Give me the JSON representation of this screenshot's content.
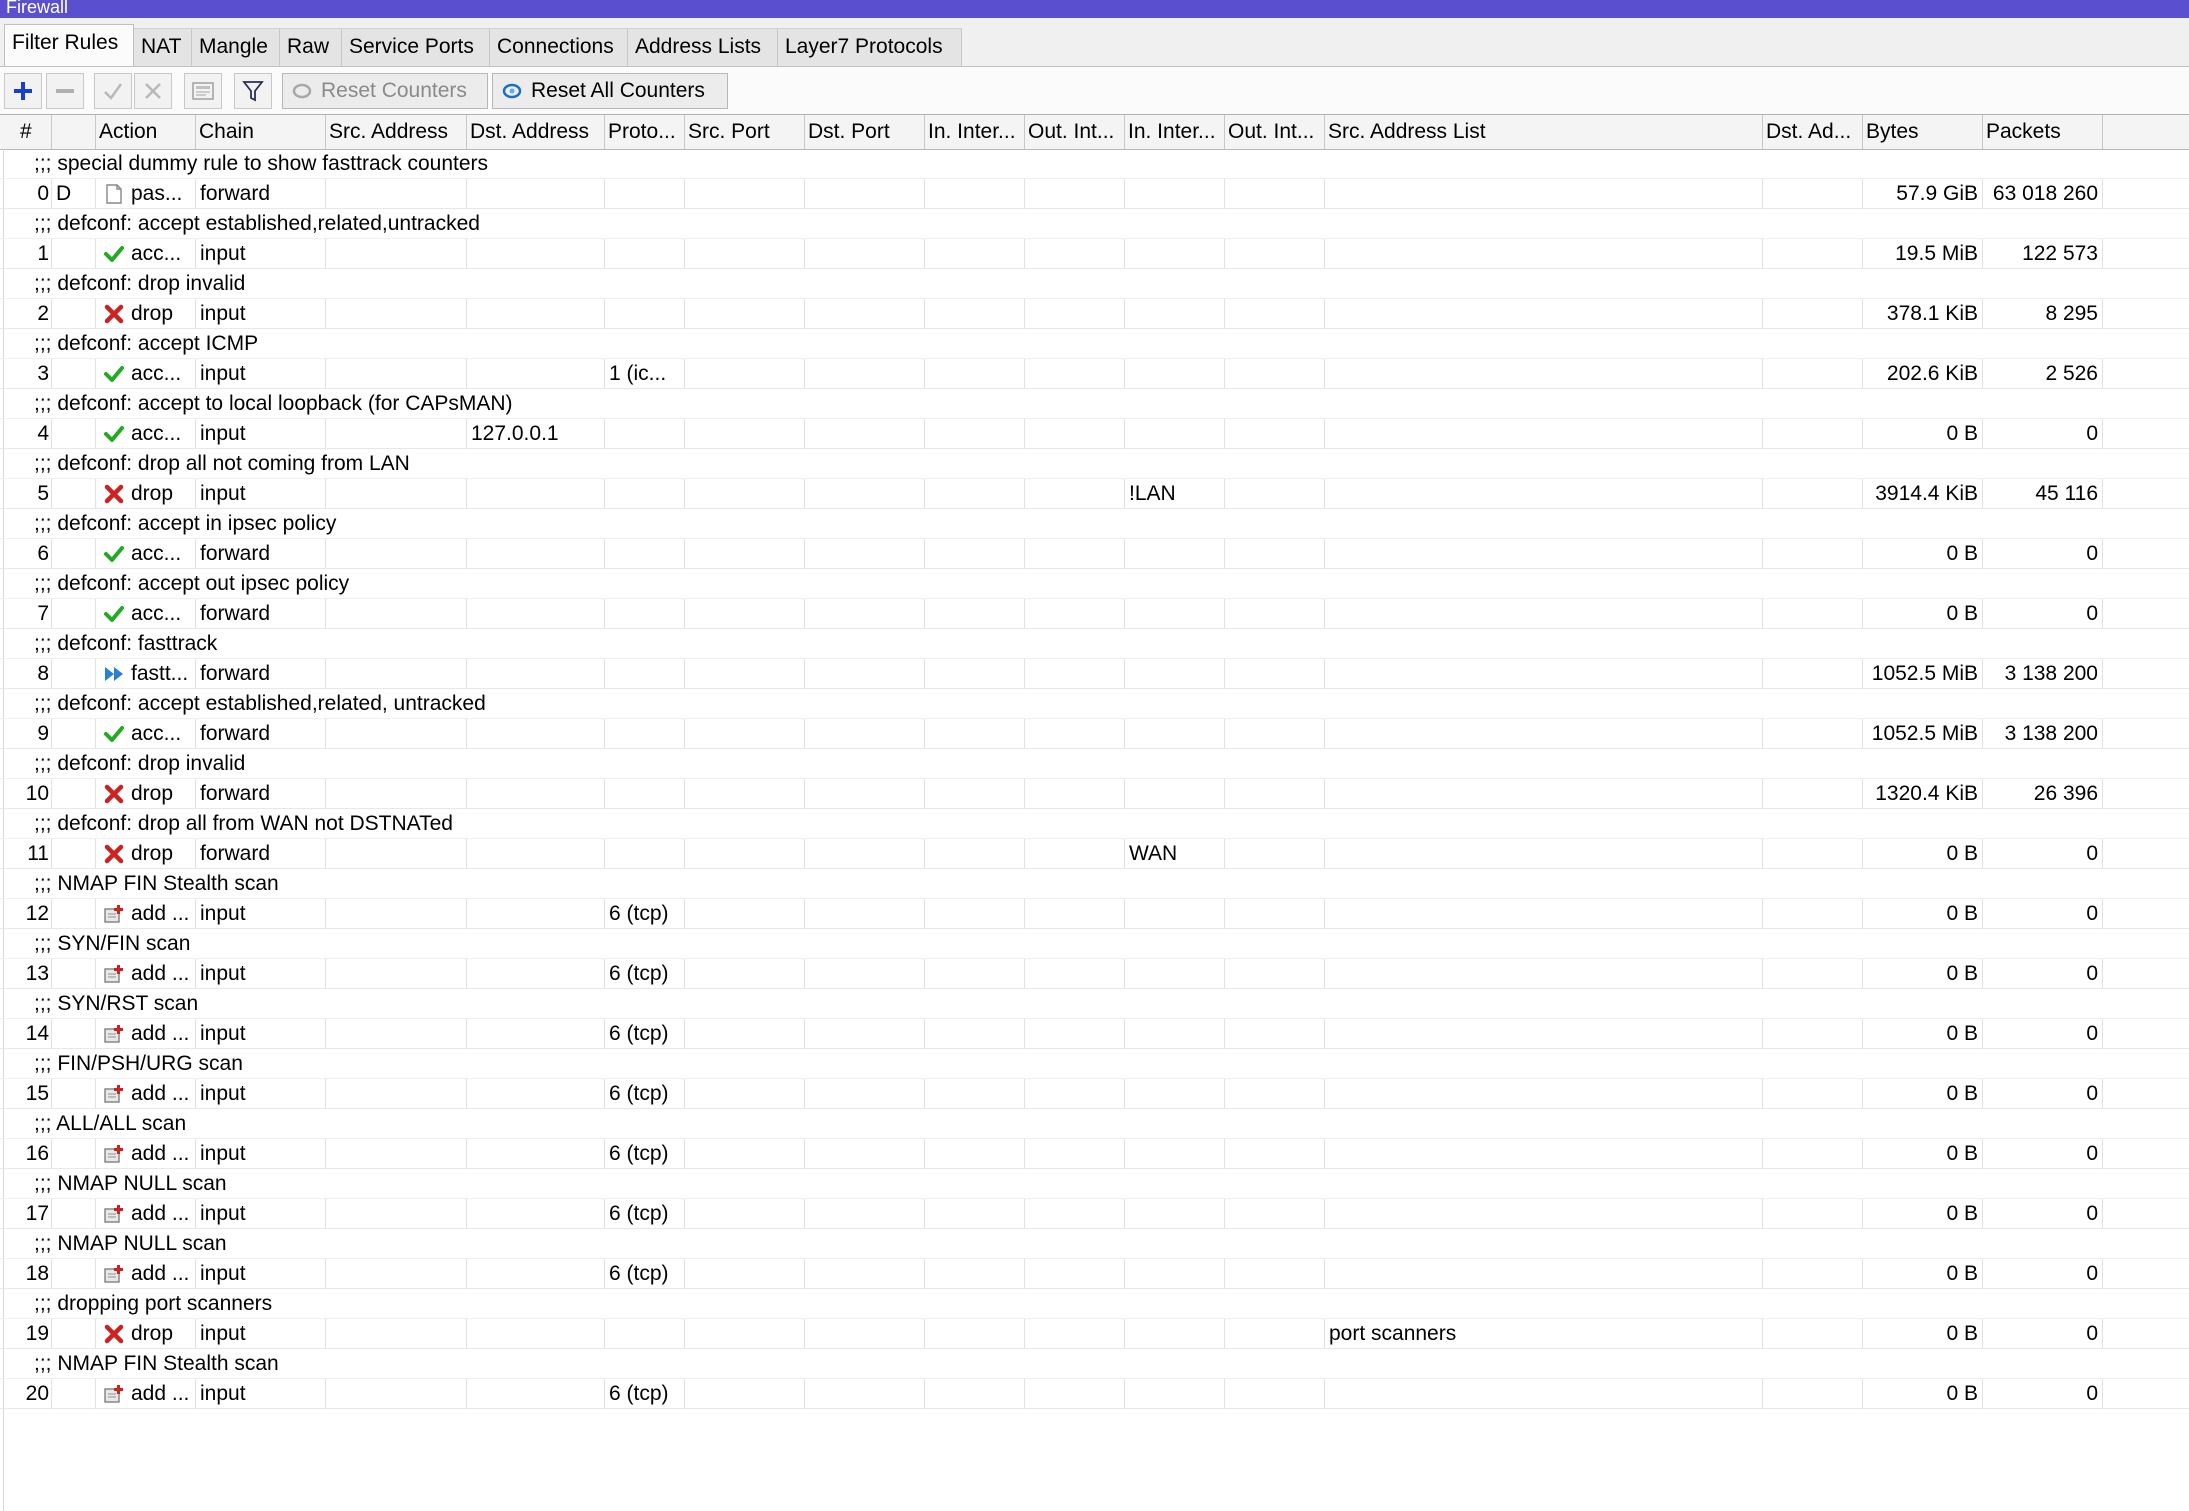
{
  "window": {
    "title": "Firewall"
  },
  "tabs": [
    "Filter Rules",
    "NAT",
    "Mangle",
    "Raw",
    "Service Ports",
    "Connections",
    "Address Lists",
    "Layer7 Protocols"
  ],
  "toolbar": {
    "reset_counters": "Reset Counters",
    "reset_all_counters": "Reset All Counters"
  },
  "columns": [
    "#",
    "",
    "Action",
    "Chain",
    "Src. Address",
    "Dst. Address",
    "Proto...",
    "Src. Port",
    "Dst. Port",
    "In. Inter...",
    "Out. Int...",
    "In. Inter...",
    "Out. Int...",
    "Src. Address List",
    "Dst. Ad...",
    "Bytes",
    "Packets"
  ],
  "rules": [
    {
      "comment": ";;; special dummy rule to show fasttrack counters",
      "num": "0",
      "flag": "D",
      "icon": "passthrough-icon",
      "action": "pas...",
      "chain": "forward",
      "src": "",
      "dst": "",
      "proto": "",
      "in_iface": "",
      "in_iface_list": "",
      "src_list": "",
      "bytes": "57.9 GiB",
      "packets": "63 018 260"
    },
    {
      "comment": ";;; defconf: accept established,related,untracked",
      "num": "1",
      "flag": "",
      "icon": "accept-icon",
      "action": "acc...",
      "chain": "input",
      "src": "",
      "dst": "",
      "proto": "",
      "in_iface": "",
      "in_iface_list": "",
      "src_list": "",
      "bytes": "19.5 MiB",
      "packets": "122 573"
    },
    {
      "comment": ";;; defconf: drop invalid",
      "num": "2",
      "flag": "",
      "icon": "drop-icon",
      "action": "drop",
      "chain": "input",
      "src": "",
      "dst": "",
      "proto": "",
      "in_iface": "",
      "in_iface_list": "",
      "src_list": "",
      "bytes": "378.1 KiB",
      "packets": "8 295"
    },
    {
      "comment": ";;; defconf: accept ICMP",
      "num": "3",
      "flag": "",
      "icon": "accept-icon",
      "action": "acc...",
      "chain": "input",
      "src": "",
      "dst": "",
      "proto": "1 (ic...",
      "in_iface": "",
      "in_iface_list": "",
      "src_list": "",
      "bytes": "202.6 KiB",
      "packets": "2 526"
    },
    {
      "comment": ";;; defconf: accept to local loopback (for CAPsMAN)",
      "num": "4",
      "flag": "",
      "icon": "accept-icon",
      "action": "acc...",
      "chain": "input",
      "src": "",
      "dst": "127.0.0.1",
      "proto": "",
      "in_iface": "",
      "in_iface_list": "",
      "src_list": "",
      "bytes": "0 B",
      "packets": "0"
    },
    {
      "comment": ";;; defconf: drop all not coming from LAN",
      "num": "5",
      "flag": "",
      "icon": "drop-icon",
      "action": "drop",
      "chain": "input",
      "src": "",
      "dst": "",
      "proto": "",
      "in_iface": "",
      "in_iface_list": "!LAN",
      "src_list": "",
      "bytes": "3914.4 KiB",
      "packets": "45 116"
    },
    {
      "comment": ";;; defconf: accept in ipsec policy",
      "num": "6",
      "flag": "",
      "icon": "accept-icon",
      "action": "acc...",
      "chain": "forward",
      "src": "",
      "dst": "",
      "proto": "",
      "in_iface": "",
      "in_iface_list": "",
      "src_list": "",
      "bytes": "0 B",
      "packets": "0"
    },
    {
      "comment": ";;; defconf: accept out ipsec policy",
      "num": "7",
      "flag": "",
      "icon": "accept-icon",
      "action": "acc...",
      "chain": "forward",
      "src": "",
      "dst": "",
      "proto": "",
      "in_iface": "",
      "in_iface_list": "",
      "src_list": "",
      "bytes": "0 B",
      "packets": "0"
    },
    {
      "comment": ";;; defconf: fasttrack",
      "num": "8",
      "flag": "",
      "icon": "fasttrack-icon",
      "action": "fastt...",
      "chain": "forward",
      "src": "",
      "dst": "",
      "proto": "",
      "in_iface": "",
      "in_iface_list": "",
      "src_list": "",
      "bytes": "1052.5 MiB",
      "packets": "3 138 200"
    },
    {
      "comment": ";;; defconf: accept established,related, untracked",
      "num": "9",
      "flag": "",
      "icon": "accept-icon",
      "action": "acc...",
      "chain": "forward",
      "src": "",
      "dst": "",
      "proto": "",
      "in_iface": "",
      "in_iface_list": "",
      "src_list": "",
      "bytes": "1052.5 MiB",
      "packets": "3 138 200"
    },
    {
      "comment": ";;; defconf: drop invalid",
      "num": "10",
      "flag": "",
      "icon": "drop-icon",
      "action": "drop",
      "chain": "forward",
      "src": "",
      "dst": "",
      "proto": "",
      "in_iface": "",
      "in_iface_list": "",
      "src_list": "",
      "bytes": "1320.4 KiB",
      "packets": "26 396"
    },
    {
      "comment": ";;; defconf: drop all from WAN not DSTNATed",
      "num": "11",
      "flag": "",
      "icon": "drop-icon",
      "action": "drop",
      "chain": "forward",
      "src": "",
      "dst": "",
      "proto": "",
      "in_iface": "",
      "in_iface_list": "WAN",
      "src_list": "",
      "bytes": "0 B",
      "packets": "0"
    },
    {
      "comment": ";;; NMAP FIN Stealth scan",
      "num": "12",
      "flag": "",
      "icon": "add-src-to-list-icon",
      "action": "add ...",
      "chain": "input",
      "src": "",
      "dst": "",
      "proto": "6 (tcp)",
      "in_iface": "",
      "in_iface_list": "",
      "src_list": "",
      "bytes": "0 B",
      "packets": "0"
    },
    {
      "comment": ";;; SYN/FIN scan",
      "num": "13",
      "flag": "",
      "icon": "add-src-to-list-icon",
      "action": "add ...",
      "chain": "input",
      "src": "",
      "dst": "",
      "proto": "6 (tcp)",
      "in_iface": "",
      "in_iface_list": "",
      "src_list": "",
      "bytes": "0 B",
      "packets": "0"
    },
    {
      "comment": ";;; SYN/RST scan",
      "num": "14",
      "flag": "",
      "icon": "add-src-to-list-icon",
      "action": "add ...",
      "chain": "input",
      "src": "",
      "dst": "",
      "proto": "6 (tcp)",
      "in_iface": "",
      "in_iface_list": "",
      "src_list": "",
      "bytes": "0 B",
      "packets": "0"
    },
    {
      "comment": ";;; FIN/PSH/URG scan",
      "num": "15",
      "flag": "",
      "icon": "add-src-to-list-icon",
      "action": "add ...",
      "chain": "input",
      "src": "",
      "dst": "",
      "proto": "6 (tcp)",
      "in_iface": "",
      "in_iface_list": "",
      "src_list": "",
      "bytes": "0 B",
      "packets": "0"
    },
    {
      "comment": ";;; ALL/ALL scan",
      "num": "16",
      "flag": "",
      "icon": "add-src-to-list-icon",
      "action": "add ...",
      "chain": "input",
      "src": "",
      "dst": "",
      "proto": "6 (tcp)",
      "in_iface": "",
      "in_iface_list": "",
      "src_list": "",
      "bytes": "0 B",
      "packets": "0"
    },
    {
      "comment": ";;; NMAP NULL scan",
      "num": "17",
      "flag": "",
      "icon": "add-src-to-list-icon",
      "action": "add ...",
      "chain": "input",
      "src": "",
      "dst": "",
      "proto": "6 (tcp)",
      "in_iface": "",
      "in_iface_list": "",
      "src_list": "",
      "bytes": "0 B",
      "packets": "0"
    },
    {
      "comment": ";;; NMAP NULL scan",
      "num": "18",
      "flag": "",
      "icon": "add-src-to-list-icon",
      "action": "add ...",
      "chain": "input",
      "src": "",
      "dst": "",
      "proto": "6 (tcp)",
      "in_iface": "",
      "in_iface_list": "",
      "src_list": "",
      "bytes": "0 B",
      "packets": "0"
    },
    {
      "comment": ";;; dropping port scanners",
      "num": "19",
      "flag": "",
      "icon": "drop-icon",
      "action": "drop",
      "chain": "input",
      "src": "",
      "dst": "",
      "proto": "",
      "in_iface": "",
      "in_iface_list": "",
      "src_list": "port scanners",
      "bytes": "0 B",
      "packets": "0"
    },
    {
      "comment": ";;; NMAP FIN Stealth scan",
      "num": "20",
      "flag": "",
      "icon": "add-src-to-list-icon",
      "action": "add ...",
      "chain": "input",
      "src": "",
      "dst": "",
      "proto": "6 (tcp)",
      "in_iface": "",
      "in_iface_list": "",
      "src_list": "",
      "bytes": "0 B",
      "packets": "0"
    }
  ],
  "colors": {
    "titlebar": "#5a4fcf",
    "accept": "#22aa22",
    "drop": "#cc2222",
    "fasttrack": "#2a7fd4",
    "add": "#1a3fcf"
  }
}
